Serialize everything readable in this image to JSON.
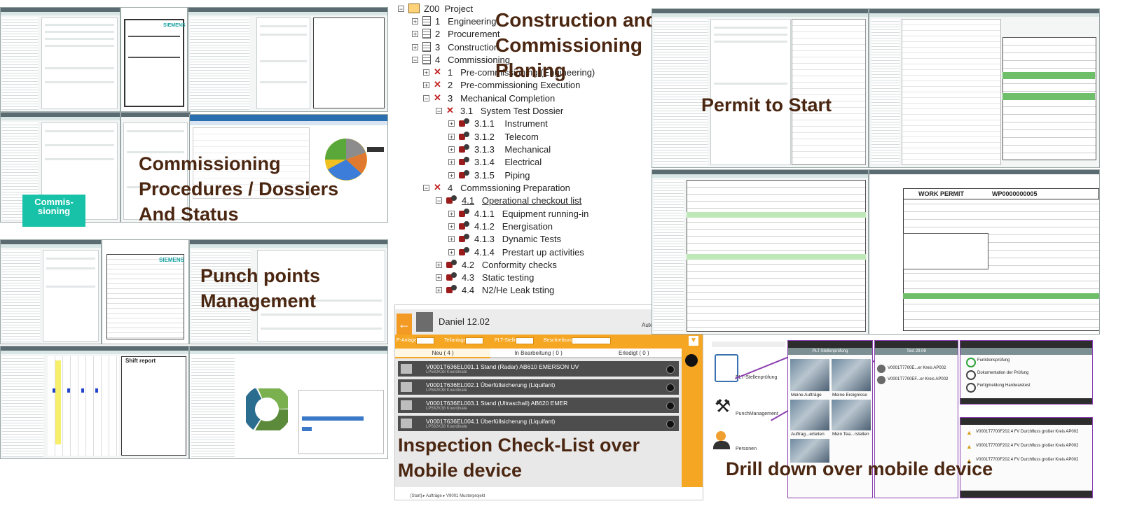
{
  "captions": {
    "construction": [
      "Construction and",
      "Commissioning",
      "Planing"
    ],
    "commissioning": [
      "Commissioning",
      "Procedures / Dossiers",
      "And Status"
    ],
    "permit": "Permit to Start",
    "punch": [
      "Punch points",
      "Management"
    ],
    "inspection": [
      "Inspection Check-List over",
      "Mobile device"
    ],
    "drill": "Drill down over mobile device"
  },
  "badge": [
    "Commis-",
    "sioning"
  ],
  "tree": [
    {
      "num": "Z00",
      "label": "Project"
    },
    {
      "num": "1",
      "label": "Engineering"
    },
    {
      "num": "2",
      "label": "Procurement"
    },
    {
      "num": "3",
      "label": "Construction"
    },
    {
      "num": "4",
      "label": "Commissioning"
    },
    {
      "num": "1",
      "label": "Pre-commissioning (Engineering)"
    },
    {
      "num": "2",
      "label": "Pre-commissioning Execution"
    },
    {
      "num": "3",
      "label": "Mechanical Completion"
    },
    {
      "num": "3.1",
      "label": "System Test Dossier"
    },
    {
      "num": "3.1.1",
      "label": "Instrument"
    },
    {
      "num": "3.1.2",
      "label": "Telecom"
    },
    {
      "num": "3.1.3",
      "label": "Mechanical"
    },
    {
      "num": "3.1.4",
      "label": "Electrical"
    },
    {
      "num": "3.1.5",
      "label": "Piping"
    },
    {
      "num": "4",
      "label": "Commssioning Preparation"
    },
    {
      "num": "4.1",
      "label": "Operational checkout list"
    },
    {
      "num": "4.1.1",
      "label": "Equipment running-in"
    },
    {
      "num": "4.1.2",
      "label": "Energisation"
    },
    {
      "num": "4.1.3",
      "label": "Dynamic Tests"
    },
    {
      "num": "4.1.4",
      "label": "Prestart up activities"
    },
    {
      "num": "4.2",
      "label": "Conformity checks"
    },
    {
      "num": "4.3",
      "label": "Static testing"
    },
    {
      "num": "4.4",
      "label": "N2/He Leak tsting"
    }
  ],
  "app": {
    "title": "Daniel 12.02",
    "auto": "Auto",
    "user": "ubik",
    "filters": [
      "P-Anlage",
      "Teilanlage",
      "PLT-Stelle",
      "Beschreibung"
    ],
    "tabs": [
      "Neu ( 4 )",
      "In Bearbeitung ( 0 )",
      "Erledigt ( 0 )"
    ],
    "items": [
      {
        "title": "V0001T636EL001.1 Stand (Radar) AB610 EMERSON UV",
        "sub": "LP582K38 Koordinate"
      },
      {
        "title": "V0001T636EL002.1 Überfüllsicherung (Liquifant)",
        "sub": "LP582K38 Koordinate"
      },
      {
        "title": "V0001T636EL003.1 Stand (Ultraschall) AB620 EMER",
        "sub": "LP582K38 Koordinate"
      },
      {
        "title": "V0001T636EL004.1 Überfüllsicherung (Liquifant)",
        "sub": "LP582K38 Koordinate"
      }
    ],
    "crumbs": "[Start]  ▸  Aufträge  ▸  V9001 Musterprojekt"
  },
  "mobile_menu": [
    "PLT-Stellenprüfung",
    "PunchManagement",
    "Personen"
  ],
  "phones": {
    "p1_title": "PLT-Stellenprüfung",
    "p1_tiles": [
      "Meine Aufträge",
      "Meine Ereignisse",
      "Auftrag...erteilen",
      "Mein Tea...rstellen"
    ],
    "p2_title": "Test 29.08",
    "p2_items": [
      "V0001T7700E...er Kreis AP002",
      "V0001T7700EF...er Kreis AP002"
    ],
    "p3_items": [
      "Funktionsprüfung",
      "Dokumentation der Prüfung",
      "Fertigmeldung Hardwaretest"
    ],
    "p4_items": [
      "V0001T7700F202.4  FV  Durchfluss großer Kreis AP002",
      "V0001T7700F202.4  FV  Durchfluss großer Kreis AP002",
      "V0001T7700F202.4  FV  Durchfluss großer Kreis AP002"
    ]
  },
  "work_permit": {
    "title": "WORK PERMIT",
    "number": "WP0000000005"
  },
  "siemens": "SIEMENS",
  "shift_report": "Shift report"
}
